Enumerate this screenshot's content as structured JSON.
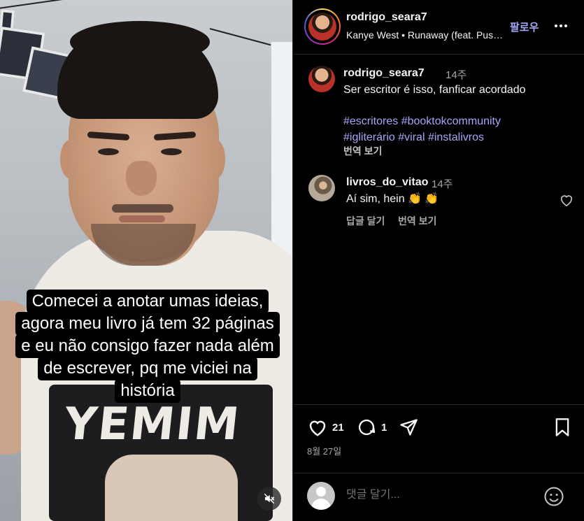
{
  "video": {
    "caption_lines": [
      "Comecei a anotar umas ideias,",
      "agora meu livro já tem 32 páginas",
      "e eu não consigo fazer nada além",
      "de escrever, pq me viciei na",
      "história"
    ],
    "shirt_print": "YEMIM"
  },
  "header": {
    "username": "rodrigo_seara7",
    "music": "Kanye West • Runaway (feat. Pus…",
    "follow_label": "팔로우"
  },
  "post": {
    "username": "rodrigo_seara7",
    "time": "14주",
    "text": "Ser escritor é isso, fanficar acordado",
    "hashtags_line1": "#escritores #booktokcommunity",
    "hashtags_line2": "#igliterário #viral #instalivros",
    "translate_label": "번역 보기"
  },
  "comment": {
    "username": "livros_do_vitao",
    "time": "14주",
    "text": "Aí sim, hein 👏 👏",
    "reply_label": "답글 달기",
    "translate_label": "번역 보기"
  },
  "actions": {
    "likes": "21",
    "comments": "1",
    "date": "8월 27일"
  },
  "add_comment": {
    "placeholder": "댓글 달기..."
  },
  "colors": {
    "link": "#a5a7f7",
    "muted": "#a8a8a8",
    "background": "#000000"
  },
  "icons": [
    "heart-icon",
    "comment-icon",
    "share-icon",
    "bookmark-icon",
    "emoji-icon",
    "mute-icon",
    "more-icon"
  ]
}
